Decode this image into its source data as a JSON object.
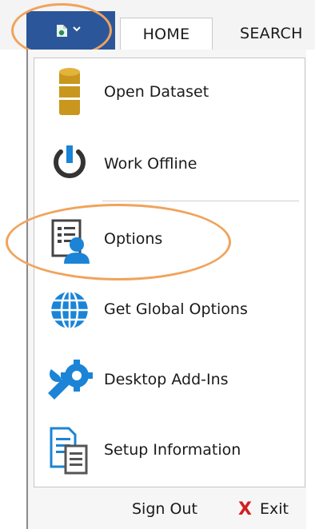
{
  "ribbon": {
    "tabs": [
      {
        "label": "HOME",
        "active": true
      },
      {
        "label": "SEARCH",
        "active": false
      }
    ],
    "app_button_color": "#2b579a"
  },
  "menu": {
    "items": [
      {
        "label": "Open Dataset",
        "icon": "database-icon"
      },
      {
        "label": "Work Offline",
        "icon": "power-icon"
      },
      {
        "label": "Options",
        "icon": "options-user-icon"
      },
      {
        "label": "Get Global Options",
        "icon": "globe-icon"
      },
      {
        "label": "Desktop Add-Ins",
        "icon": "wrench-gear-icon"
      },
      {
        "label": "Setup Information",
        "icon": "setup-document-icon"
      }
    ],
    "footer": {
      "sign_out": "Sign Out",
      "exit": "Exit",
      "exit_glyph": "X"
    }
  },
  "colors": {
    "highlight_ring": "#f0a35c",
    "accent_blue": "#1b84d6",
    "database_gold": "#c9961e",
    "exit_red": "#d21f1f"
  }
}
